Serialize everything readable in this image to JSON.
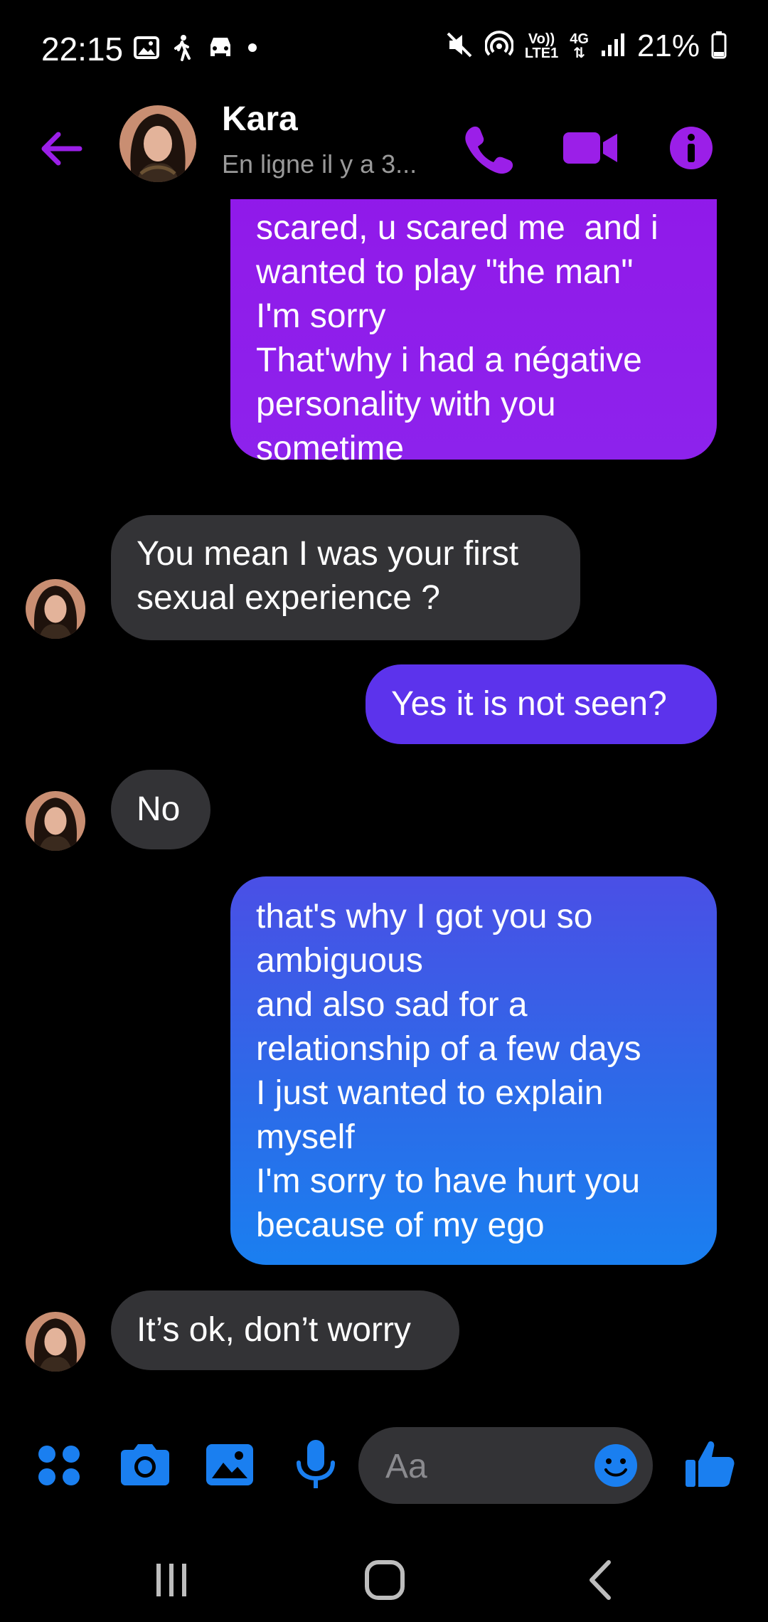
{
  "status_bar": {
    "time": "22:15",
    "volte_line1": "Vo))",
    "volte_line2": "LTE1",
    "network": "4G",
    "battery_percent": "21%"
  },
  "header": {
    "name": "Kara",
    "status": "En ligne il y a 3..."
  },
  "messages": [
    {
      "from": "me",
      "lines": [
        "scared, u scared me  and i",
        "wanted to play \"the man\"",
        "I'm sorry",
        "That'why i had a négative",
        "personality with you",
        "sometime"
      ]
    },
    {
      "from": "them",
      "lines": [
        "You mean I was your first",
        "sexual experience ?"
      ]
    },
    {
      "from": "me",
      "lines": [
        "Yes it is not seen?"
      ]
    },
    {
      "from": "them",
      "lines": [
        "No"
      ]
    },
    {
      "from": "me",
      "lines": [
        "that's why I got you so",
        "ambiguous",
        "and also sad for a",
        "relationship of a few days",
        "I just wanted to explain",
        "myself",
        "I'm sorry to have hurt you",
        "because of my ego"
      ]
    },
    {
      "from": "them",
      "lines": [
        "It’s ok, don’t worry"
      ]
    }
  ],
  "composer": {
    "placeholder": "Aa"
  },
  "colors": {
    "accent_purple": "#9b1fe8",
    "accent_blue": "#1a7ff0",
    "incoming_bubble": "#333336"
  }
}
